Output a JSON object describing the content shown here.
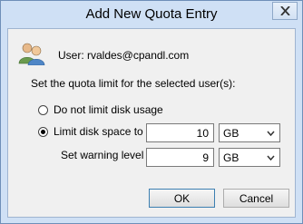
{
  "window": {
    "title": "Add New Quota Entry"
  },
  "user": {
    "label": "User:",
    "value": "rvaldes@cpandl.com"
  },
  "instruction": "Set the quota limit for the selected user(s):",
  "options": {
    "no_limit_label": "Do not limit disk usage",
    "limit_label": "Limit disk space to",
    "selected": "limit"
  },
  "limit": {
    "value": "10",
    "unit": "GB"
  },
  "warning": {
    "label": "Set warning level to",
    "value": "9",
    "unit": "GB"
  },
  "buttons": {
    "ok": "OK",
    "cancel": "Cancel"
  },
  "icons": {
    "users": "users-icon",
    "close": "close-icon",
    "dropdown": "chevron-down-icon"
  }
}
